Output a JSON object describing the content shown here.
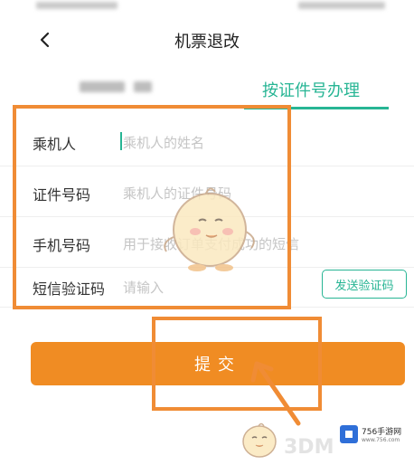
{
  "header": {
    "title": "机票退改"
  },
  "tabs": {
    "active_label": "按证件号办理"
  },
  "form": {
    "rows": [
      {
        "label": "乘机人",
        "placeholder": "乘机人的姓名"
      },
      {
        "label": "证件号码",
        "placeholder": "乘机人的证件号码"
      },
      {
        "label": "手机号码",
        "placeholder": "用于接收订单支付成功的短信"
      },
      {
        "label": "短信验证码",
        "placeholder": "请输入"
      }
    ],
    "send_code_label": "发送验证码"
  },
  "submit_label": "提交",
  "watermark": {
    "brand": "3DM",
    "site": "756手游网",
    "site_url": "www.756.com"
  },
  "colors": {
    "accent": "#27b594",
    "submit": "#f08c23",
    "highlight": "#f08c35"
  }
}
